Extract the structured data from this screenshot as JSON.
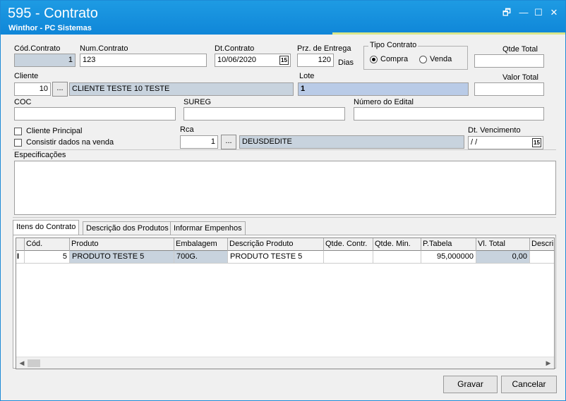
{
  "window": {
    "title": "595 - Contrato",
    "subtitle": "Winthor - PC Sistemas",
    "controls": {
      "restore": "🗗",
      "min": "—",
      "max": "☐",
      "close": "✕"
    }
  },
  "form": {
    "cod_contrato": {
      "label": "Cód.Contrato",
      "value": "1"
    },
    "num_contrato": {
      "label": "Num.Contrato",
      "value": "123"
    },
    "dt_contrato": {
      "label": "Dt.Contrato",
      "value": "10/06/2020"
    },
    "prz_entrega": {
      "label": "Prz. de Entrega",
      "value": "120",
      "unit": "Dias"
    },
    "tipo_contrato": {
      "label": "Tipo Contrato",
      "options": [
        "Compra",
        "Venda"
      ],
      "selected": "Compra"
    },
    "qtde_total": {
      "label": "Qtde Total",
      "value": ""
    },
    "cliente": {
      "label": "Cliente",
      "code": "10",
      "name": "CLIENTE TESTE 10 TESTE"
    },
    "lote": {
      "label": "Lote",
      "value": "1"
    },
    "valor_total": {
      "label": "Valor Total",
      "value": ""
    },
    "coc": {
      "label": "COC",
      "value": ""
    },
    "sureg": {
      "label": "SUREG",
      "value": ""
    },
    "numero_edital": {
      "label": "Número do Edital",
      "value": ""
    },
    "cliente_principal": {
      "label": "Cliente Principal",
      "checked": false
    },
    "consistir": {
      "label": "Consistir dados na venda",
      "checked": false
    },
    "rca": {
      "label": "Rca",
      "code": "1",
      "name": "DEUSDEDITE"
    },
    "dt_vencimento": {
      "label": "Dt. Vencimento",
      "value": " /  /"
    },
    "especificacoes": {
      "label": "Especificações",
      "value": ""
    },
    "lookup_button": "..."
  },
  "tabs": [
    "Itens do Contrato",
    "Descrição dos Produtos",
    "Informar Empenhos"
  ],
  "grid": {
    "columns": [
      "",
      "Cód.",
      "Produto",
      "Embalagem",
      "Descrição Produto",
      "Qtde. Contr.",
      "Qtde. Min.",
      "P.Tabela",
      "Vl. Total",
      "Descri"
    ],
    "rows": [
      [
        "I",
        "5",
        "PRODUTO TESTE 5",
        "700G.",
        "PRODUTO TESTE 5",
        "",
        "",
        "95,000000",
        "0,00",
        ""
      ]
    ]
  },
  "buttons": {
    "gravar": "Gravar",
    "cancelar": "Cancelar"
  },
  "colors": {
    "titlebar": "#1190dc",
    "readonly": "#c8d3de",
    "accent": "#d9e68a"
  }
}
